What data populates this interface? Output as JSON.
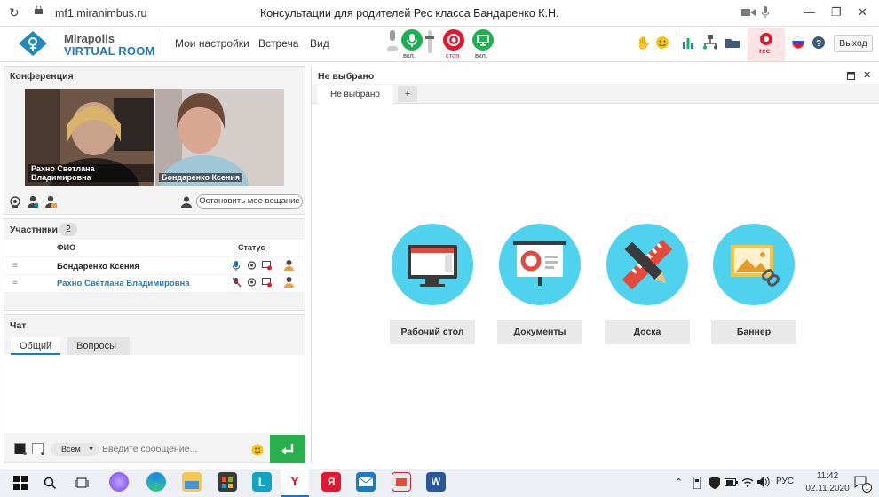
{
  "browser": {
    "url": "mf1.miranimbus.ru",
    "title": "Консультации для родителей Рес класса Бандаренко К.Н."
  },
  "app": {
    "logo_top": "Mirapolis",
    "logo_bottom": "VIRTUAL ROOM",
    "menu": [
      "Мои настройки",
      "Встреча",
      "Вид"
    ],
    "mic_label": "вкл.",
    "cam_label": "стоп",
    "screen_label": "вкл.",
    "rec_label": "rec",
    "exit_label": "Выход"
  },
  "conference": {
    "title": "Конференция",
    "video1_name": "Рахно Светлана  Владимировна",
    "video2_name": "Бондаренко  Ксения",
    "stop_broadcast": "Остановить мое вещание"
  },
  "participants": {
    "title": "Участники",
    "count": "2",
    "col_name": "ФИО",
    "col_status": "Статус",
    "rows": [
      {
        "name": "Бондаренко  Ксения"
      },
      {
        "name": "Рахно Светлана  Владимировна"
      }
    ]
  },
  "chat": {
    "title": "Чат",
    "tab_general": "Общий",
    "tab_questions": "Вопросы",
    "recipient": "Всем",
    "placeholder": "Введите сообщение..."
  },
  "workspace": {
    "title": "Не выбрано",
    "tab_label": "Не выбрано",
    "add_tab": "+",
    "tiles": [
      "Рабочий стол",
      "Документы",
      "Доска",
      "Баннер"
    ]
  },
  "taskbar": {
    "lang": "РУС",
    "time": "11:42",
    "date": "02.11.2020",
    "notifications": "1"
  },
  "colors": {
    "green": "#1fae54",
    "red": "#e2182e",
    "tile": "#4fd2ee",
    "blue": "#1e7bbd"
  }
}
